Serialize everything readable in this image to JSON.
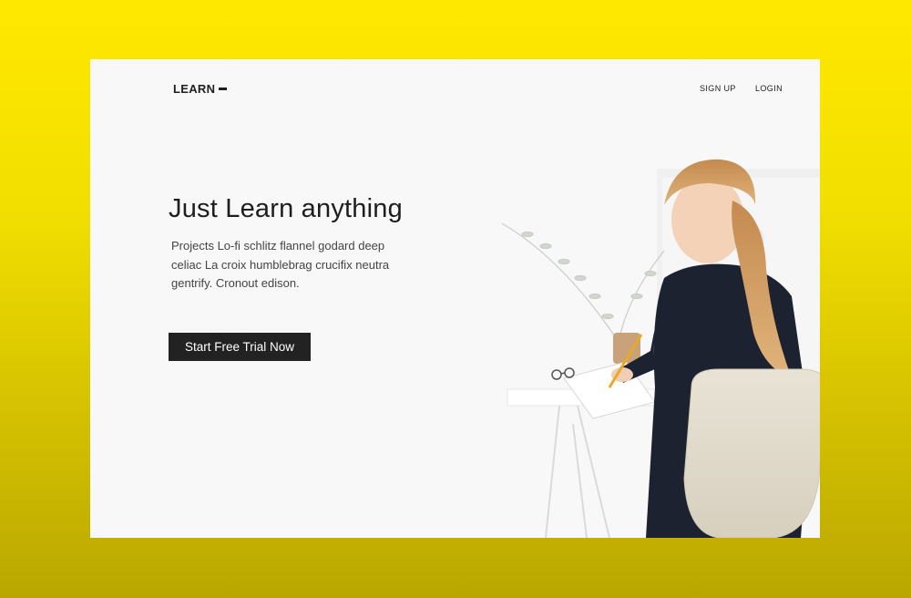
{
  "header": {
    "logo_text": "LEARN",
    "nav": [
      {
        "label": "SIGN UP"
      },
      {
        "label": "LOGIN"
      }
    ]
  },
  "hero": {
    "headline": "Just Learn anything",
    "description": "Projects Lo-fi schlitz flannel godard deep celiac La croix humblebrag crucifix neutra gentrify. Cronout edison.",
    "cta_label": "Start Free Trial Now"
  },
  "colors": {
    "background_yellow": "#ffe800",
    "card_background": "#f8f8f9",
    "button_background": "#222222",
    "button_text": "#ffffff"
  },
  "icons": {
    "logo_mark": "dash-icon"
  }
}
